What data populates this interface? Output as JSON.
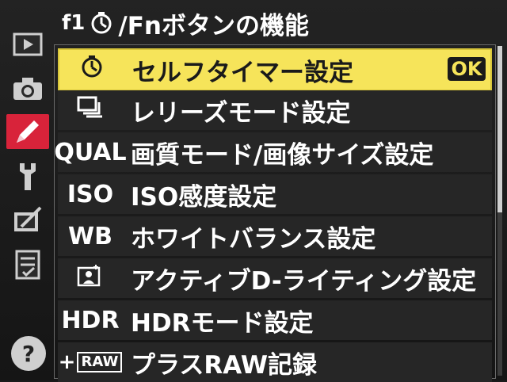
{
  "header": {
    "code": "f1",
    "title": "/Fnボタンの機能"
  },
  "sidebar": {
    "tabs": [
      {
        "name": "playback-menu-icon"
      },
      {
        "name": "shooting-menu-icon"
      },
      {
        "name": "custom-settings-icon",
        "active": true
      },
      {
        "name": "setup-menu-icon"
      },
      {
        "name": "retouch-menu-icon"
      },
      {
        "name": "my-menu-icon"
      }
    ],
    "help": "?"
  },
  "menu": {
    "ok": "OK",
    "items": [
      {
        "code": "",
        "icon": "self-timer-icon",
        "label": "セルフタイマー設定",
        "selected": true
      },
      {
        "code": "",
        "icon": "release-mode-icon",
        "label": "レリーズモード設定"
      },
      {
        "code": "QUAL",
        "label": "画質モード/画像サイズ設定"
      },
      {
        "code": "ISO",
        "label": "ISO感度設定"
      },
      {
        "code": "WB",
        "label": "ホワイトバランス設定"
      },
      {
        "code": "",
        "icon": "active-d-lighting-icon",
        "label": "アクティブD-ライティング設定"
      },
      {
        "code": "HDR",
        "label": "HDRモード設定"
      },
      {
        "code": "RAW",
        "code_prefix": "+",
        "label": "プラスRAW記録"
      }
    ]
  },
  "colors": {
    "selected_bg": "#f6e45a",
    "active_tab": "#d8233a",
    "row_bg": "#262626"
  }
}
